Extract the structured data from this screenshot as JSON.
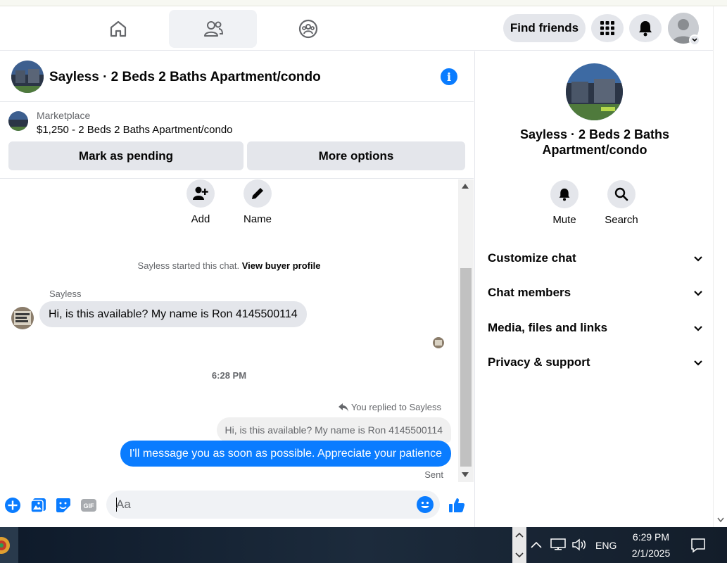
{
  "topnav": {
    "tabs": [
      {
        "name": "home-icon"
      },
      {
        "name": "friends-icon",
        "active": true
      },
      {
        "name": "groups-icon"
      }
    ],
    "find_friends_label": "Find friends",
    "icons": [
      "menu-grid-icon",
      "bell-icon",
      "profile-avatar"
    ]
  },
  "chat": {
    "title": "Sayless · 2 Beds 2 Baths Apartment/condo",
    "listing_source": "Marketplace",
    "listing_desc": "$1,250 - 2 Beds 2 Baths Apartment/condo",
    "mark_pending_label": "Mark as pending",
    "more_options_label": "More options",
    "actions": [
      {
        "label": "Add",
        "icon": "add-person-icon"
      },
      {
        "label": "Name",
        "icon": "pencil-icon"
      }
    ],
    "started_text": "Sayless started this chat.",
    "view_profile_link": "View buyer profile",
    "sender_name": "Sayless",
    "incoming_message": "Hi, is this available? My name is Ron 4145500114",
    "timestamp": "6:28 PM",
    "reply_note": "You replied to Sayless",
    "quoted_message": "Hi, is this available? My name is Ron 4145500114",
    "outgoing_message": "I'll message you as soon as possible. Appreciate your patience",
    "status": "Sent",
    "composer_placeholder": "Aa",
    "composer_icons": [
      "plus-circle-icon",
      "photo-icon",
      "sticker-icon",
      "gif-icon",
      "emoji-icon",
      "like-icon"
    ]
  },
  "panel": {
    "title": "Sayless · 2 Beds 2 Baths Apartment/condo",
    "actions": [
      {
        "label": "Mute",
        "icon": "bell-icon"
      },
      {
        "label": "Search",
        "icon": "search-icon"
      }
    ],
    "sections": [
      "Customize chat",
      "Chat members",
      "Media, files and links",
      "Privacy & support"
    ]
  },
  "taskbar": {
    "lang": "ENG",
    "time": "6:29 PM",
    "date": "2/1/2025"
  },
  "colors": {
    "accent": "#0a7cff",
    "grey_button": "#e4e6eb",
    "secondary_text": "#65676b"
  }
}
